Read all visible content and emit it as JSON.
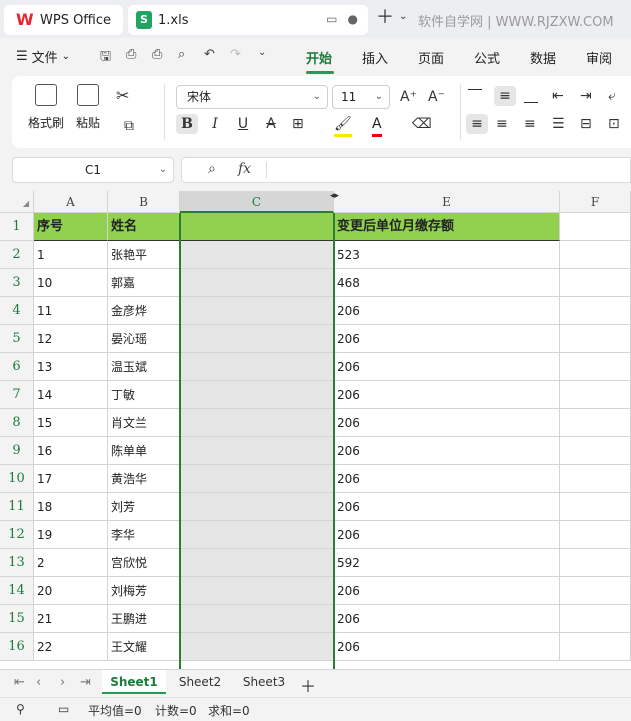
{
  "titlebar": {
    "home_tab": "WPS Office",
    "file_tab": "1.xls",
    "watermark": "软件自学网 | WWW.RJZXW.COM"
  },
  "menubar": {
    "file": "文件",
    "tabs": [
      "开始",
      "插入",
      "页面",
      "公式",
      "数据",
      "审阅"
    ],
    "active_tab": "开始"
  },
  "ribbon": {
    "format_painter": "格式刷",
    "paste": "粘贴",
    "font_name": "宋体",
    "font_size": "11",
    "bold": "B",
    "italic": "I",
    "underline": "U",
    "strike": "A"
  },
  "formula_bar": {
    "name_box": "C1",
    "fx": "fx",
    "content": ""
  },
  "grid": {
    "columns": [
      "A",
      "B",
      "C",
      "E",
      "F"
    ],
    "selected_column": "C",
    "header_row": {
      "A": "序号",
      "B": "姓名",
      "C": "",
      "E": "变更后单位月缴存额"
    },
    "rows": [
      {
        "n": "1",
        "A": "序号",
        "B": "姓名",
        "E": "变更后单位月缴存额"
      },
      {
        "n": "2",
        "A": "1",
        "B": "张艳平",
        "E": "523"
      },
      {
        "n": "3",
        "A": "10",
        "B": "郭嘉",
        "E": "468"
      },
      {
        "n": "4",
        "A": "11",
        "B": "金彦烨",
        "E": "206"
      },
      {
        "n": "5",
        "A": "12",
        "B": "晏沁瑶",
        "E": "206"
      },
      {
        "n": "6",
        "A": "13",
        "B": "温玉斌",
        "E": "206"
      },
      {
        "n": "7",
        "A": "14",
        "B": "丁敏",
        "E": "206"
      },
      {
        "n": "8",
        "A": "15",
        "B": "肖文兰",
        "E": "206"
      },
      {
        "n": "9",
        "A": "16",
        "B": "陈单单",
        "E": "206"
      },
      {
        "n": "10",
        "A": "17",
        "B": "黄浩华",
        "E": "206"
      },
      {
        "n": "11",
        "A": "18",
        "B": "刘芳",
        "E": "206"
      },
      {
        "n": "12",
        "A": "19",
        "B": "李华",
        "E": "206"
      },
      {
        "n": "13",
        "A": "2",
        "B": "宫欣悦",
        "E": "592"
      },
      {
        "n": "14",
        "A": "20",
        "B": "刘梅芳",
        "E": "206"
      },
      {
        "n": "15",
        "A": "21",
        "B": "王鹏进",
        "E": "206"
      },
      {
        "n": "16",
        "A": "22",
        "B": "王文耀",
        "E": "206"
      }
    ]
  },
  "sheets": [
    "Sheet1",
    "Sheet2",
    "Sheet3"
  ],
  "active_sheet": "Sheet1",
  "status": {
    "average": "平均值=0",
    "count": "计数=0",
    "sum": "求和=0"
  },
  "colors": {
    "accent": "#1f9d55",
    "header_fill": "#92d050",
    "selection_border": "#2e7d32"
  }
}
